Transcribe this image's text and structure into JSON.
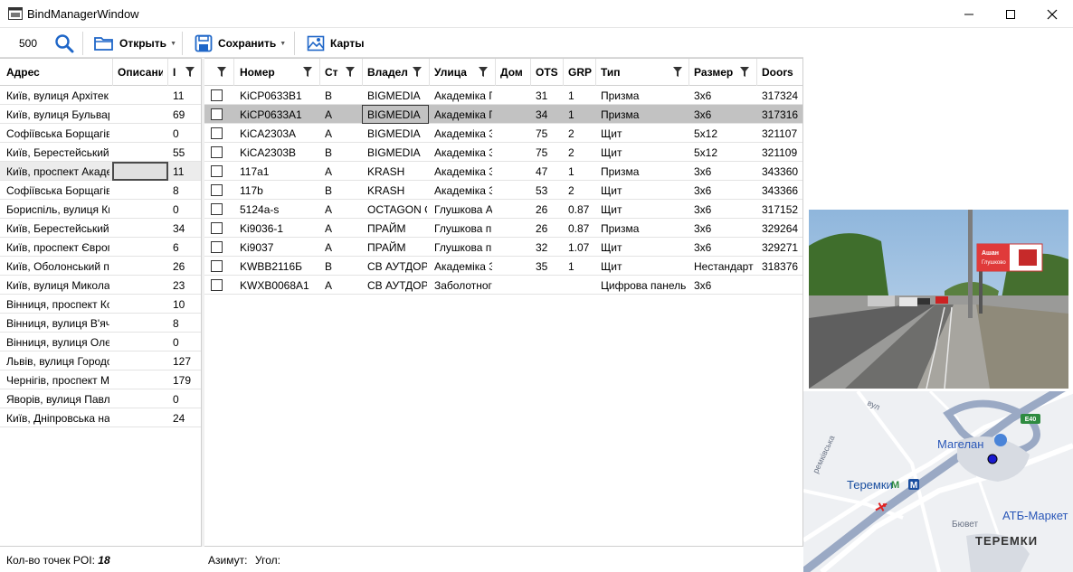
{
  "window": {
    "title": "BindManagerWindow"
  },
  "toolbar": {
    "count": "500",
    "open_label": "Открыть",
    "save_label": "Сохранить",
    "maps_label": "Карты"
  },
  "left_table": {
    "headers": [
      "Адрес",
      "Описани",
      "I"
    ],
    "rows": [
      {
        "address": "Київ, вулиця Архітек",
        "desc": "",
        "count": "11"
      },
      {
        "address": "Київ, вулиця Бульвар",
        "desc": "",
        "count": "69"
      },
      {
        "address": "Софіївська Борщагів",
        "desc": "",
        "count": "0"
      },
      {
        "address": "Київ, Берестейський",
        "desc": "",
        "count": "55"
      },
      {
        "address": "Київ, проспект Акаде",
        "desc": "",
        "count": "11"
      },
      {
        "address": "Софіївська Борщагів",
        "desc": "",
        "count": "8"
      },
      {
        "address": "Бориспіль, вулиця Ки",
        "desc": "",
        "count": "0"
      },
      {
        "address": "Київ, Берестейський",
        "desc": "",
        "count": "34"
      },
      {
        "address": "Київ, проспект Європ",
        "desc": "",
        "count": "6"
      },
      {
        "address": "Київ, Оболонський п",
        "desc": "",
        "count": "26"
      },
      {
        "address": "Київ, вулиця Микола",
        "desc": "",
        "count": "23"
      },
      {
        "address": "Вінниця, проспект Ко",
        "desc": "",
        "count": "10"
      },
      {
        "address": "Вінниця, вулиця В'яч",
        "desc": "",
        "count": "8"
      },
      {
        "address": "Вінниця, вулиця Оле",
        "desc": "",
        "count": "0"
      },
      {
        "address": "Львів, вулиця Городо",
        "desc": "",
        "count": "127"
      },
      {
        "address": "Чернігів, проспект М",
        "desc": "",
        "count": "179"
      },
      {
        "address": "Яворів, вулиця Павл",
        "desc": "",
        "count": "0"
      },
      {
        "address": "Київ, Дніпровська на",
        "desc": "",
        "count": "24"
      }
    ]
  },
  "right_table": {
    "headers": [
      "Номер",
      "Ст",
      "Владел",
      "Улица",
      "Дом",
      "OTS",
      "GRP",
      "Тип",
      "Размер",
      "Doors"
    ],
    "rows": [
      {
        "num": "KiCP0633B1",
        "st": "B",
        "owner": "BIGMEDIA",
        "street": "Академіка Г",
        "house": "",
        "ots": "31",
        "grp": "1",
        "type": "Призма",
        "size": "3x6",
        "doors": "317324"
      },
      {
        "num": "KiCP0633A1",
        "st": "A",
        "owner": "BIGMEDIA",
        "street": "Академіка Г",
        "house": "",
        "ots": "34",
        "grp": "1",
        "type": "Призма",
        "size": "3x6",
        "doors": "317316"
      },
      {
        "num": "KiCA2303A",
        "st": "A",
        "owner": "BIGMEDIA",
        "street": "Академіка З",
        "house": "",
        "ots": "75",
        "grp": "2",
        "type": "Щит",
        "size": "5x12",
        "doors": "321107"
      },
      {
        "num": "KiCA2303B",
        "st": "B",
        "owner": "BIGMEDIA",
        "street": "Академіка З",
        "house": "",
        "ots": "75",
        "grp": "2",
        "type": "Щит",
        "size": "5x12",
        "doors": "321109"
      },
      {
        "num": "117a1",
        "st": "A",
        "owner": "KRASH",
        "street": "Академіка З",
        "house": "",
        "ots": "47",
        "grp": "1",
        "type": "Призма",
        "size": "3x6",
        "doors": "343360"
      },
      {
        "num": "117b",
        "st": "B",
        "owner": "KRASH",
        "street": "Академіка З",
        "house": "",
        "ots": "53",
        "grp": "2",
        "type": "Щит",
        "size": "3x6",
        "doors": "343366"
      },
      {
        "num": "5124a-s",
        "st": "A",
        "owner": "OCTAGON C",
        "street": "Глушкова А",
        "house": "",
        "ots": "26",
        "grp": "0.87",
        "type": "Щит",
        "size": "3x6",
        "doors": "317152"
      },
      {
        "num": "Ki9036-1",
        "st": "A",
        "owner": "ПРАЙМ",
        "street": "Глушкова п",
        "house": "",
        "ots": "26",
        "grp": "0.87",
        "type": "Призма",
        "size": "3x6",
        "doors": "329264"
      },
      {
        "num": "Ki9037",
        "st": "A",
        "owner": "ПРАЙМ",
        "street": "Глушкова п",
        "house": "",
        "ots": "32",
        "grp": "1.07",
        "type": "Щит",
        "size": "3x6",
        "doors": "329271"
      },
      {
        "num": "KWBB2116Б",
        "st": "B",
        "owner": "СВ АУТДОР",
        "street": "Академіка З",
        "house": "",
        "ots": "35",
        "grp": "1",
        "type": "Щит",
        "size": "Нестандарт",
        "doors": "318376"
      },
      {
        "num": "KWXB0068A1",
        "st": "A",
        "owner": "СВ АУТДОР",
        "street": "Заболотног",
        "house": "",
        "ots": "",
        "grp": "",
        "type": "Цифрова панель",
        "size": "3x6",
        "doors": ""
      }
    ]
  },
  "status": {
    "poi_label": "Кол-во точек POI:",
    "poi_count": "18",
    "azimuth_label": "Азимут:",
    "angle_label": "Угол:"
  },
  "photo": {
    "sign_line1": "Ашан",
    "sign_line2": "Глушково"
  },
  "map": {
    "labels": [
      "вул",
      "ремківська",
      "Магелан",
      "Теремки",
      "АТБ-Маркет",
      "Бювет",
      "ТЕРЕМКИ",
      "E40"
    ]
  },
  "colors": {
    "selected_row": "#c2c2c2",
    "metro": "#1a4fa0",
    "accent": "#1e66c8"
  }
}
